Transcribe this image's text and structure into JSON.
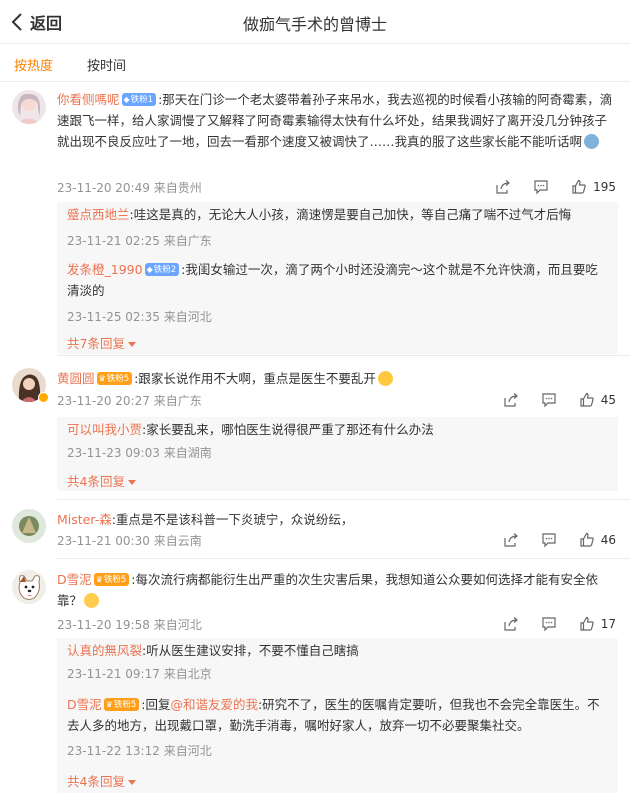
{
  "header": {
    "back_label": "返回",
    "title": "做痂气手术的曾博士"
  },
  "sort": {
    "hot": "按热度",
    "time": "按时间"
  },
  "comments": [
    {
      "user": "你看侧嗎呢",
      "badge": "铁粉1",
      "text": ":那天在门诊一个老太婆带着孙子来吊水，我去巡视的时候看小孩输的阿奇霉素，滴速跟飞一样，给人家调慢了又解释了阿奇霉素输得太快有什么坏处，结果我调好了离开没几分钟孩子就出现不良反应吐了一地，回去一看那个速度又被调快了……我真的服了这些家长能不能听话啊",
      "time": "23-11-20 20:49",
      "location": "来自贵州",
      "likes": "195",
      "replies": [
        {
          "user": "蹙点西地兰",
          "text": ":哇这是真的，无论大人小孩，滴速愣是要自己加快，等自己痛了喘不过气才后悔",
          "time": "23-11-21 02:25",
          "location": "来自广东"
        },
        {
          "user": "发条橙_1990",
          "badge": "铁粉2",
          "text": ":我闺女输过一次，滴了两个小时还没滴完～这个就是不允许快滴，而且要吃清淡的",
          "time": "23-11-25 02:35",
          "location": "来自河北"
        }
      ],
      "more": "共7条回复"
    },
    {
      "user": "黄圆圆",
      "badge": "铁粉5",
      "text": ":跟家长说作用不大啊，重点是医生不要乱开",
      "time": "23-11-20 20:27",
      "location": "来自广东",
      "likes": "45",
      "replies": [
        {
          "user": "可以叫我小贾",
          "text": ":家长要乱来，哪怕医生说得很严重了那还有什么办法",
          "time": "23-11-23 09:03",
          "location": "来自湖南"
        }
      ],
      "more": "共4条回复"
    },
    {
      "user": "Mister-森",
      "text": ":重点是不是该科普一下炎琥宁，众说纷纭，",
      "time": "23-11-21 00:30",
      "location": "来自云南",
      "likes": "46"
    },
    {
      "user": "D雪泥",
      "badge": "铁粉5",
      "text": ":每次流行病都能衍生出严重的次生灾害后果，我想知道公众要如何选择才能有安全依靠？",
      "time": "23-11-20 19:58",
      "location": "来自河北",
      "likes": "17",
      "replies": [
        {
          "user": "认真的無风裂",
          "text": ":听从医生建议安排，不要不懂自己瞎搞",
          "time": "23-11-21 09:17",
          "location": "来自北京"
        },
        {
          "user": "D雪泥",
          "badge": "铁粉5",
          "reply_to": "@和谐友爱的我",
          "text": ":研究不了，医生的医嘱肯定要听，但我也不会完全靠医生。不去人多的地方，出现戴口罩，勤洗手消毒，嘱咐好家人，放弃一切不必要聚集社交。",
          "reply_prefix": ":回复",
          "time": "23-11-22 13:12",
          "location": "来自河北"
        }
      ],
      "more": "共4条回复"
    }
  ],
  "colors": {
    "accent": "#ff8200",
    "username": "#eb7350",
    "meta": "#939393"
  },
  "icons": [
    "chevron-left-icon",
    "share-icon",
    "comment-icon",
    "like-icon"
  ]
}
